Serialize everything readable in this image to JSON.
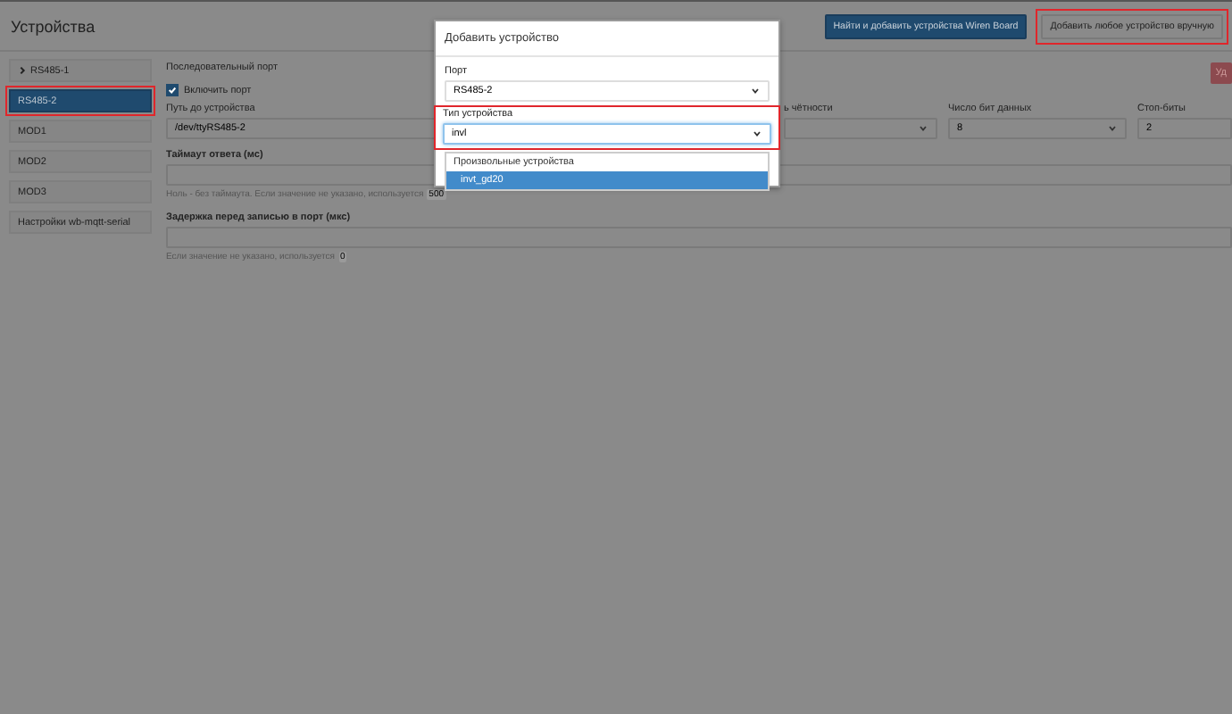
{
  "header": {
    "title": "Устройства",
    "buttons": [
      {
        "label": "Найти и добавить устройства Wiren Board",
        "kind": "primary",
        "highlighted": false
      },
      {
        "label": "Добавить любое устройство вручную",
        "kind": "default",
        "highlighted": true
      }
    ]
  },
  "sidebar": {
    "items": [
      {
        "label": "RS485-1",
        "selected": false,
        "expanded": false,
        "highlighted": false
      },
      {
        "label": "RS485-2",
        "selected": true,
        "highlighted": true
      },
      {
        "label": "MOD1",
        "selected": false,
        "highlighted": false
      },
      {
        "label": "MOD2",
        "selected": false,
        "highlighted": false
      },
      {
        "label": "MOD3",
        "selected": false,
        "highlighted": false
      },
      {
        "label": "Настройки wb-mqtt-serial",
        "selected": false,
        "highlighted": false
      }
    ]
  },
  "form": {
    "section": "Последовательный порт",
    "delete_button": "Уд",
    "enable": {
      "label": "Включить порт",
      "checked": true
    },
    "fields": [
      {
        "label": "Путь до устройства",
        "value": "/dev/ttyRS485-2",
        "kind": "input"
      },
      {
        "label": "ь чётности",
        "kind": "select"
      },
      {
        "label": "Число бит данных",
        "value": "8",
        "kind": "select"
      },
      {
        "label": "Стоп-биты",
        "value": "2",
        "kind": "input"
      }
    ],
    "timeout": {
      "label": "Таймаут ответа (мс)",
      "hint": "Ноль - без таймаута. Если значение не указано, используется",
      "badge": "500"
    },
    "delay": {
      "label": "Задержка перед записью в порт (мкс)",
      "hint": "Если значение не указано, используется",
      "badge": "0"
    }
  },
  "dialog": {
    "title": "Добавить устройство",
    "port": {
      "label": "Порт",
      "value": "RS485-2"
    },
    "device_type": {
      "label": "Тип устройства",
      "value": "invl",
      "highlighted": true
    },
    "dropdown": {
      "group": "Произвольные устройства",
      "options": [
        {
          "label": "invt_gd20",
          "selected": true
        }
      ]
    }
  }
}
